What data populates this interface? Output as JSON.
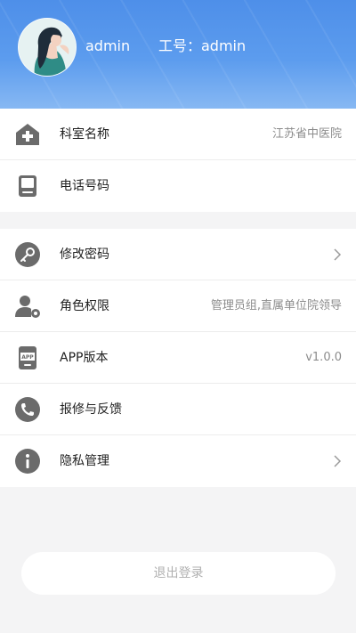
{
  "profile": {
    "username": "admin",
    "job_label": "工号：admin"
  },
  "menu_group1": [
    {
      "label": "科室名称",
      "value": "江苏省中医院",
      "icon": "hospital-icon"
    },
    {
      "label": "电话号码",
      "value": "",
      "icon": "phone-device-icon"
    }
  ],
  "menu_group2": [
    {
      "label": "修改密码",
      "value": "",
      "icon": "key-icon",
      "chevron": true
    },
    {
      "label": "角色权限",
      "value": "管理员组,直属单位院领导",
      "icon": "user-settings-icon"
    },
    {
      "label": "APP版本",
      "value": "v1.0.0",
      "icon": "app-icon"
    },
    {
      "label": "报修与反馈",
      "value": "",
      "icon": "call-icon"
    },
    {
      "label": "隐私管理",
      "value": "",
      "icon": "info-icon",
      "chevron": true
    }
  ],
  "logout_label": "退出登录",
  "colors": {
    "header_blue": "#4e8fe9",
    "icon_gray": "#6b6b6b",
    "background": "#f4f4f5"
  }
}
